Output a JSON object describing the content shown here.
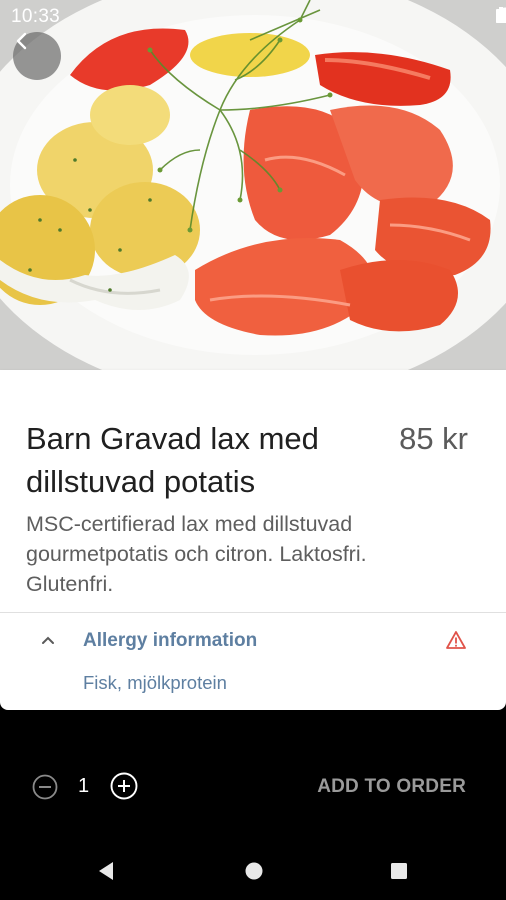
{
  "status_bar": {
    "time": "10:33",
    "icons": [
      "wifi-icon",
      "signal-icon",
      "battery-icon"
    ]
  },
  "header": {
    "back_icon": "arrow-back-icon"
  },
  "hero_image": {
    "subject": "food-photo"
  },
  "product": {
    "title": "Barn Gravad lax med dillstuvad potatis",
    "price": "85 kr",
    "description": "MSC-certifierad lax med dillstuvad gourmetpotatis och citron. Laktosfri. Glutenfri."
  },
  "allergy": {
    "title": "Allergy information",
    "content": "Fisk, mjölkprotein",
    "icons": [
      "chevron-up-icon",
      "warning-icon"
    ],
    "accent_color": "#5e7fa1",
    "warning_color": "#e0534a"
  },
  "order": {
    "quantity": "1",
    "add_label": "ADD TO ORDER",
    "icons": [
      "minus-circle-icon",
      "plus-circle-icon"
    ]
  },
  "nav_bar": {
    "icons": [
      "nav-back-icon",
      "nav-home-icon",
      "nav-recents-icon"
    ]
  }
}
